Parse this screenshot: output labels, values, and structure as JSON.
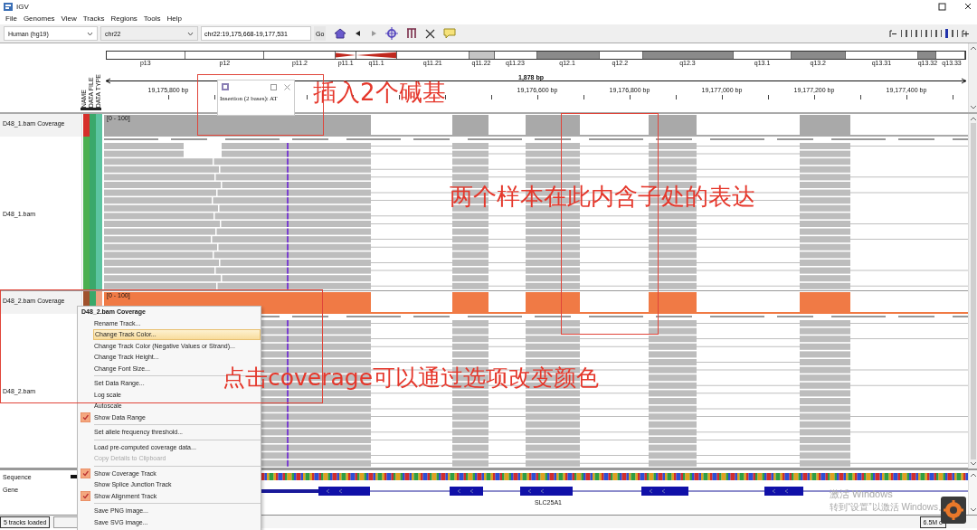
{
  "window": {
    "title": "IGV"
  },
  "menu": [
    "File",
    "Genomes",
    "View",
    "Tracks",
    "Regions",
    "Tools",
    "Help"
  ],
  "toolbar": {
    "genome": "Human (hg19)",
    "chromosome": "chr22",
    "locus": "chr22:19,175,668-19,177,531",
    "go": "Go"
  },
  "ideogram": {
    "bands": [
      {
        "label": "p13",
        "kind": "white"
      },
      {
        "label": "p12",
        "kind": "white"
      },
      {
        "label": "p11.2",
        "kind": "white"
      },
      {
        "label": "p11.1",
        "kind": "acen_p"
      },
      {
        "label": "q11.1",
        "kind": "acen_q"
      },
      {
        "label": "q11.21",
        "kind": "white"
      },
      {
        "label": "q11.22",
        "kind": "light"
      },
      {
        "label": "q11.23",
        "kind": "white"
      },
      {
        "label": "q12.1",
        "kind": "dark"
      },
      {
        "label": "q12.2",
        "kind": "white"
      },
      {
        "label": "q12.3",
        "kind": "dark"
      },
      {
        "label": "q13.1",
        "kind": "white"
      },
      {
        "label": "q13.2",
        "kind": "dark"
      },
      {
        "label": "q13.31",
        "kind": "white"
      },
      {
        "label": "q13.32",
        "kind": "dark"
      },
      {
        "label": "q13.33",
        "kind": "white"
      }
    ]
  },
  "ruler": {
    "span": "1,878 bp",
    "ticks": [
      "19,175,800 bp",
      "19,176,600 bp",
      "19,176,800 bp",
      "19,177,000 bp",
      "19,177,200 bp",
      "19,177,400 bp"
    ]
  },
  "attribute_headers": [
    "NAME",
    "DATA FILE",
    "DATA TYPE"
  ],
  "tracks": [
    {
      "coverage_name": "D48_1.bam Coverage",
      "data_range": "[0 - 100]",
      "color": "#a9a9a9",
      "alignment_name": "D48_1.bam",
      "coverage_attributes": [
        {
          "color": "#d62f2a"
        },
        {
          "color": "#3aa86a"
        },
        {
          "color": "#5cc4a0"
        }
      ],
      "alignment_attributes": [
        {
          "color": "#4caf50"
        },
        {
          "color": "#3aa86a"
        },
        {
          "color": "#5cc4a0"
        }
      ]
    },
    {
      "coverage_name": "D48_2.bam Coverage",
      "data_range": "[0 - 100]",
      "color": "#f07a45",
      "alignment_name": "D48_2.bam",
      "coverage_attributes": [
        {
          "color": "#a0522d"
        },
        {
          "color": "#3aa86a"
        },
        {
          "color": "#f0a080"
        }
      ]
    }
  ],
  "features": [
    {
      "name": "Sequence",
      "kind": "sequence"
    },
    {
      "name": "Gene",
      "kind": "gene",
      "gene_label": "SLC25A1"
    }
  ],
  "popup": {
    "text": "Insertion (2 bases): AT"
  },
  "context_menu": {
    "title": "D48_2.bam Coverage",
    "items": [
      {
        "kind": "action",
        "label": "Rename Track...",
        "selected": false,
        "disabled": false
      },
      {
        "kind": "action",
        "label": "Change Track Color...",
        "selected": true,
        "disabled": false
      },
      {
        "kind": "action",
        "label": "Change Track Color (Negative Values or Strand)...",
        "selected": false,
        "disabled": false
      },
      {
        "kind": "action",
        "label": "Change Track Height...",
        "selected": false,
        "disabled": false
      },
      {
        "kind": "action",
        "label": "Change Font Size...",
        "selected": false,
        "disabled": false
      },
      {
        "kind": "separator"
      },
      {
        "kind": "action",
        "label": "Set Data Range...",
        "selected": false,
        "disabled": false
      },
      {
        "kind": "check",
        "label": "Log scale",
        "checked": false,
        "selected": false,
        "disabled": false
      },
      {
        "kind": "check",
        "label": "Autoscale",
        "checked": false,
        "selected": false,
        "disabled": false
      },
      {
        "kind": "check",
        "label": "Show Data Range",
        "checked": true,
        "selected": false,
        "disabled": false
      },
      {
        "kind": "separator"
      },
      {
        "kind": "action",
        "label": "Set allele frequency threshold...",
        "selected": false,
        "disabled": false
      },
      {
        "kind": "separator"
      },
      {
        "kind": "action",
        "label": "Load pre-computed coverage data...",
        "selected": false,
        "disabled": false
      },
      {
        "kind": "action",
        "label": "Copy Details to Clipboard",
        "selected": false,
        "disabled": true
      },
      {
        "kind": "separator"
      },
      {
        "kind": "check",
        "label": "Show Coverage Track",
        "checked": true,
        "selected": false,
        "disabled": false
      },
      {
        "kind": "check",
        "label": "Show Splice Junction Track",
        "checked": false,
        "selected": false,
        "disabled": false
      },
      {
        "kind": "check",
        "label": "Show Alignment Track",
        "checked": true,
        "selected": false,
        "disabled": false
      },
      {
        "kind": "separator"
      },
      {
        "kind": "action",
        "label": "Save PNG image...",
        "selected": false,
        "disabled": false
      },
      {
        "kind": "action",
        "label": "Save SVG image...",
        "selected": false,
        "disabled": false
      }
    ]
  },
  "status_bar": {
    "message": "5 tracks loaded",
    "memory": "6.5M o"
  },
  "annotations": [
    "插入2个碱基",
    "两个样本在此内含子处的表达",
    "点击coverage可以通过选项改变颜色"
  ],
  "os_notice": {
    "title": "激活 Windows",
    "text": "转到“设置”以激活 Windows。"
  }
}
